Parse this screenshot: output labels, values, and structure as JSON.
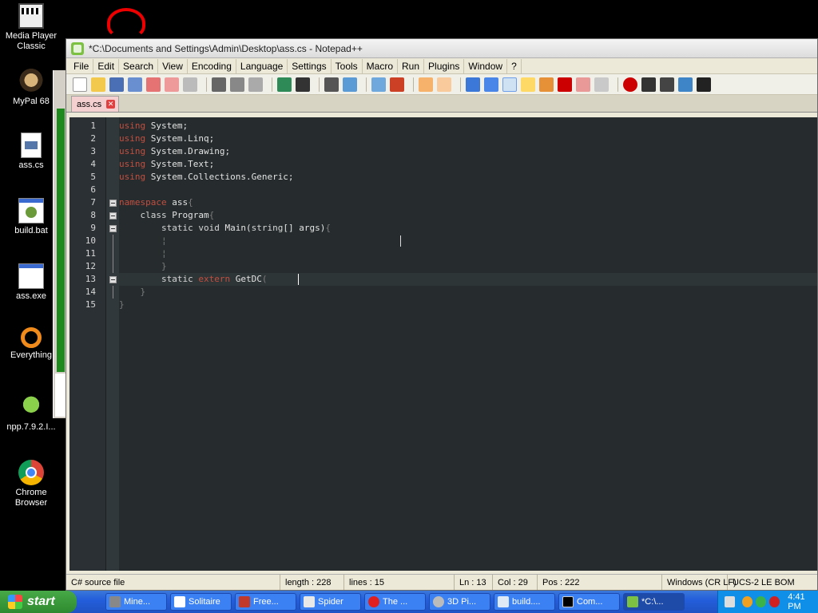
{
  "desktop_icons": [
    {
      "label": "Media Player Classic",
      "icon": "media-player-icon"
    },
    {
      "label": "MyPal 68",
      "icon": "mypal-icon"
    },
    {
      "label": "ass.cs",
      "icon": "cs-file-icon"
    },
    {
      "label": "build.bat",
      "icon": "bat-file-icon"
    },
    {
      "label": "ass.exe",
      "icon": "exe-file-icon"
    },
    {
      "label": "Everything",
      "icon": "everything-icon"
    },
    {
      "label": "npp.7.9.2.I...",
      "icon": "npp-installer-icon"
    },
    {
      "label": "Chrome Browser",
      "icon": "chrome-icon"
    }
  ],
  "window": {
    "title": "*C:\\Documents and Settings\\Admin\\Desktop\\ass.cs - Notepad++"
  },
  "menu": [
    "File",
    "Edit",
    "Search",
    "View",
    "Encoding",
    "Language",
    "Settings",
    "Tools",
    "Macro",
    "Run",
    "Plugins",
    "Window",
    "?"
  ],
  "tab": {
    "label": "ass.cs"
  },
  "editor": {
    "line_numbers": [
      "1",
      "2",
      "3",
      "4",
      "5",
      "6",
      "7",
      "8",
      "9",
      "10",
      "11",
      "12",
      "13",
      "14",
      "15"
    ]
  },
  "status": {
    "file_type": "C# source file",
    "length": "length : 228",
    "lines": "lines : 15",
    "ln": "Ln : 13",
    "col": "Col : 29",
    "pos": "Pos : 222",
    "eol": "Windows (CR LF)",
    "encoding": "UCS-2 LE BOM"
  },
  "taskbar": {
    "start": "start",
    "tasks": [
      "Mine...",
      "Solitaire",
      "Free...",
      "Spider",
      "The ...",
      "3D Pi...",
      "build....",
      "Com...",
      "*C:\\..."
    ],
    "clock": "4:41 PM"
  },
  "colors": {
    "editor_bg": "#262c2e",
    "keyword": "#c24e3f",
    "taskbar": "#245edb"
  }
}
